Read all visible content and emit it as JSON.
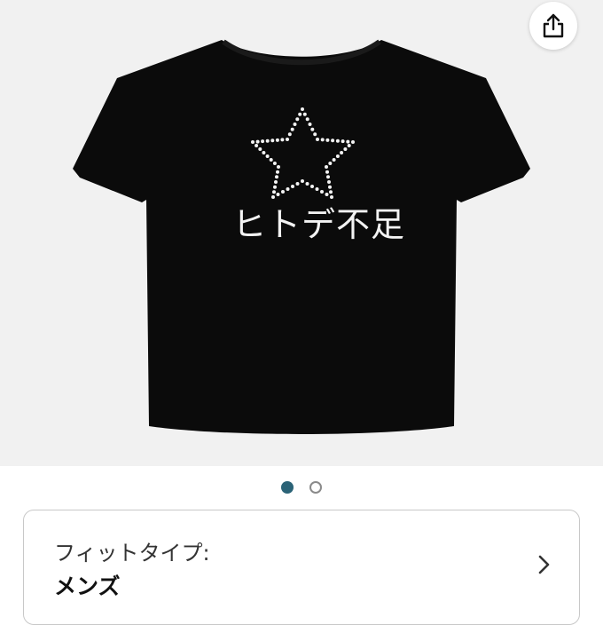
{
  "product": {
    "print_text": "ヒトデ不足",
    "shirt_color": "#0b0b0b"
  },
  "gallery": {
    "active_index": 1,
    "total": 2
  },
  "share": {
    "icon": "share-icon"
  },
  "fit_type": {
    "label": "フィットタイプ:",
    "value": "メンズ",
    "chevron_icon": "chevron-right-icon"
  }
}
